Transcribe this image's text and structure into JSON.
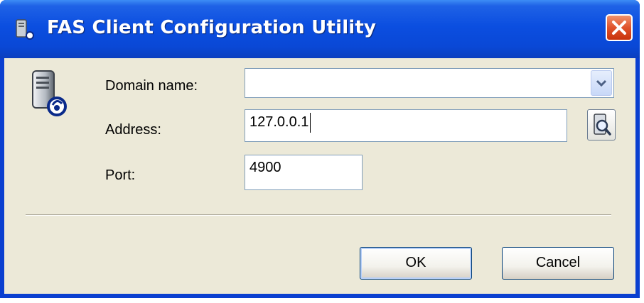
{
  "window": {
    "title": "FAS Client Configuration Utility"
  },
  "icons": {
    "title": "server-connection-icon",
    "app": "server-connection-icon",
    "close": "close-icon",
    "dropdown": "chevron-down-icon",
    "browse": "search-server-icon"
  },
  "form": {
    "domain_label": "Domain name:",
    "domain_value": "",
    "address_label": "Address:",
    "address_value": "127.0.0.1",
    "port_label": "Port:",
    "port_value": "4900"
  },
  "buttons": {
    "ok": "OK",
    "cancel": "Cancel"
  },
  "colors": {
    "titlebar": "#0a48d6",
    "client": "#ece9d8",
    "close": "#e0522b"
  }
}
